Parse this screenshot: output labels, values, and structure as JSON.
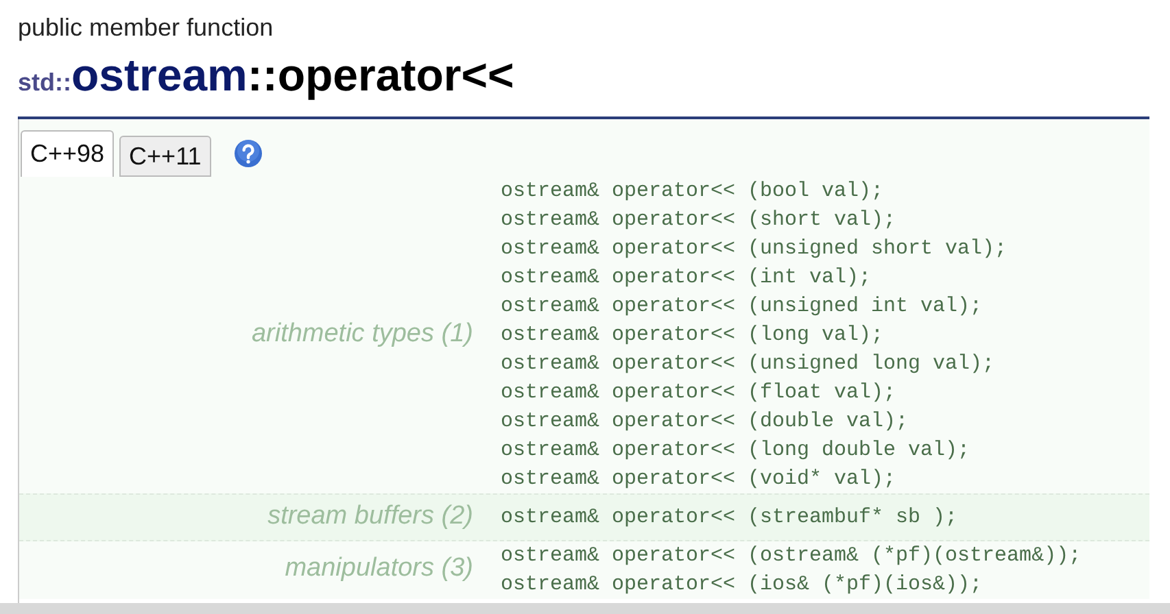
{
  "category": "public member function",
  "title": {
    "namespace": "std::",
    "class": "ostream",
    "member": "::operator<<"
  },
  "tabs": [
    {
      "label": "C++98",
      "selected": true
    },
    {
      "label": "C++11",
      "selected": false
    }
  ],
  "groups": [
    {
      "label": "arithmetic types (1)",
      "highlighted": false,
      "lines": [
        "ostream& operator<< (bool val);",
        "ostream& operator<< (short val);",
        "ostream& operator<< (unsigned short val);",
        "ostream& operator<< (int val);",
        "ostream& operator<< (unsigned int val);",
        "ostream& operator<< (long val);",
        "ostream& operator<< (unsigned long val);",
        "ostream& operator<< (float val);",
        "ostream& operator<< (double val);",
        "ostream& operator<< (long double val);",
        "ostream& operator<< (void* val);"
      ]
    },
    {
      "label": "stream buffers (2)",
      "highlighted": true,
      "lines": [
        "ostream& operator<< (streambuf* sb );"
      ]
    },
    {
      "label": "manipulators (3)",
      "highlighted": false,
      "lines": [
        "ostream& operator<< (ostream& (*pf)(ostream&));",
        "ostream& operator<< (ios& (*pf)(ios&));"
      ]
    }
  ]
}
